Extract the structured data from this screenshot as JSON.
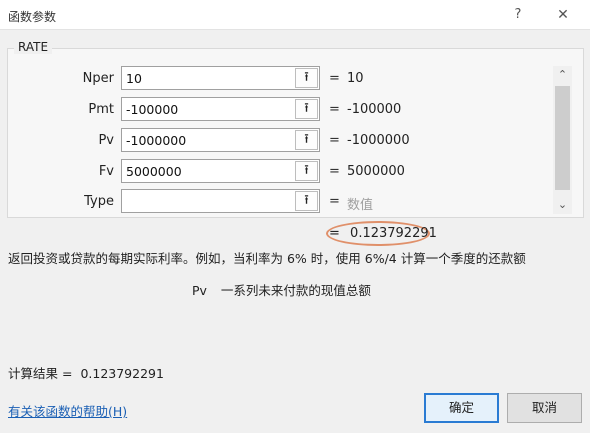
{
  "window": {
    "title": "函数参数",
    "help_glyph": "?",
    "close_glyph": "✕"
  },
  "function_name": "RATE",
  "arguments": [
    {
      "label": "Nper",
      "value": "10",
      "result": "10"
    },
    {
      "label": "Pmt",
      "value": "-100000",
      "result": "-100000"
    },
    {
      "label": "Pv",
      "value": "-1000000",
      "result": "-1000000"
    },
    {
      "label": "Fv",
      "value": "5000000",
      "result": "5000000"
    },
    {
      "label": "Type",
      "value": "",
      "result": "数值"
    }
  ],
  "equals": "=",
  "collapse_icon_glyph": "⭱",
  "scrollbar": {
    "up_glyph": "⌃",
    "down_glyph": "⌄"
  },
  "formula_result": "0.123792291",
  "description": "返回投资或贷款的每期实际利率。例如，当利率为 6% 时，使用 6%/4 计算一个季度的还款额",
  "argument_help": {
    "name": "Pv",
    "text": "一系列未来付款的现值总额"
  },
  "calc_result": {
    "label": "计算结果 =",
    "value": "0.123792291"
  },
  "help_link": "有关该函数的帮助(H)",
  "buttons": {
    "ok": "确定",
    "cancel": "取消"
  },
  "colors": {
    "highlight": "#e0906a",
    "link": "#1a5fb4",
    "default_button_border": "#2a7bd3"
  }
}
